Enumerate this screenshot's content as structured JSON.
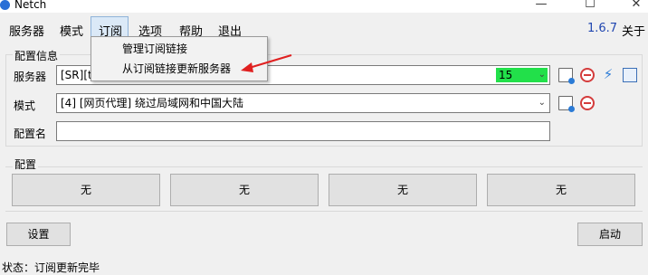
{
  "window": {
    "title": "Netch",
    "minimize": "—",
    "maximize": "☐",
    "close": "✕"
  },
  "menu": {
    "items": [
      "服务器",
      "模式",
      "订阅",
      "选项",
      "帮助",
      "退出"
    ],
    "version": "1.6.7",
    "about": "关于"
  },
  "dropdown": {
    "items": [
      "管理订阅链接",
      "从订阅链接更新服务器"
    ]
  },
  "config": {
    "group_label": "配置信息",
    "server_label": "服务器",
    "server_value": "[SR][t",
    "server_latency": "15",
    "mode_label": "模式",
    "mode_value": "[4] [网页代理] 绕过局域网和中国大陆",
    "name_label": "配置名",
    "name_value": ""
  },
  "configure": {
    "group_label": "配置",
    "buttons": [
      "无",
      "无",
      "无",
      "无"
    ]
  },
  "buttons": {
    "settings": "设置",
    "start": "启动"
  },
  "status": "状态：订阅更新完毕",
  "colors": {
    "latency_bg": "#22e04a",
    "version": "#2046b0",
    "annotation_arrow": "#e02020"
  },
  "icons": [
    "edit-icon",
    "delete-icon",
    "speed-test-icon",
    "copy-icon"
  ]
}
